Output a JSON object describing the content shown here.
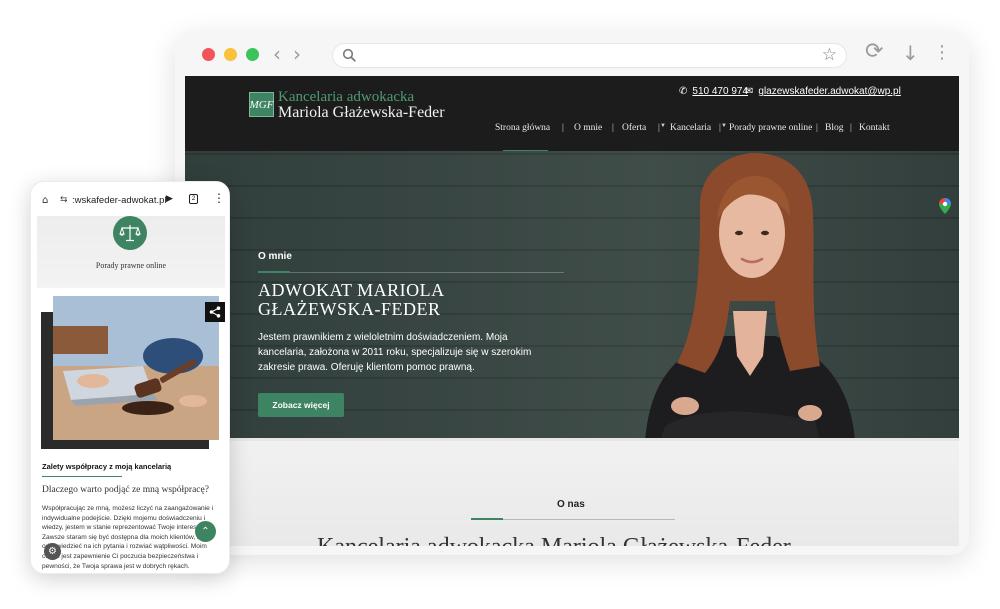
{
  "desktop": {
    "chrome": {
      "back_glyph": "‹",
      "forward_glyph": "›",
      "star_glyph": "☆",
      "reload_glyph": "⟳",
      "download_glyph": "↓",
      "menu_glyph": "⋮"
    },
    "header": {
      "logo_monogram": "MGF",
      "logo_line1": "Kancelaria adwokacka",
      "logo_line2": "Mariola Głażewska-Feder",
      "phone": "510 470 974",
      "email": "glazewskafeder.adwokat@wp.pl",
      "phone_icon": "✆",
      "mail_icon": "✉"
    },
    "nav": {
      "items": [
        "Strona główna",
        "O mnie",
        "Oferta",
        "Kancelaria",
        "Porady prawne online",
        "Blog",
        "Kontakt"
      ],
      "separator": "|",
      "active_index": 0
    },
    "hero": {
      "label": "O mnie",
      "title_line1": "ADWOKAT MARIOLA",
      "title_line2": "GŁAŻEWSKA-FEDER",
      "text": "Jestem prawnikiem z wieloletnim doświadczeniem. Moja kancelaria, założona w 2011 roku, specjalizuje się w szerokim zakresie prawa. Oferuję klientom pomoc prawną.",
      "button": "Zobacz więcej"
    },
    "about": {
      "label": "O nas",
      "title": "Kancelaria adwokacka Mariola Głażewska-Feder"
    }
  },
  "mobile": {
    "url": ":wskafeder-adwokat.pl",
    "home_icon": "⌂",
    "tune_icon": "⇆",
    "play_icon": "▶",
    "tabs_count": "2",
    "menu_icon": "⋮",
    "badge_text": "Porady prawne online",
    "share_icon": "⋖",
    "section_label": "Zalety współpracy z moją kancelarią",
    "section_title": "Dlaczego warto podjąć ze mną współpracę?",
    "section_text": "Współpracując ze mną, możesz liczyć na zaangażowanie i indywidualne podejście. Dzięki mojemu doświadczeniu i wiedzy, jestem w stanie reprezentować Twoje interesy. Zawsze staram się być dostępna dla moich klientów, aby odpowiedzieć na ich pytania i rozwiać wątpliwości. Moim celem jest zapewnienie Ci poczucia bezpieczeństwa i pewności, że Twoja sprawa jest w dobrych rękach.",
    "up_icon": "⌃",
    "gear_icon": "⚙"
  },
  "colors": {
    "accent_green": "#3f8462",
    "header_dark": "#1c1c1c"
  }
}
